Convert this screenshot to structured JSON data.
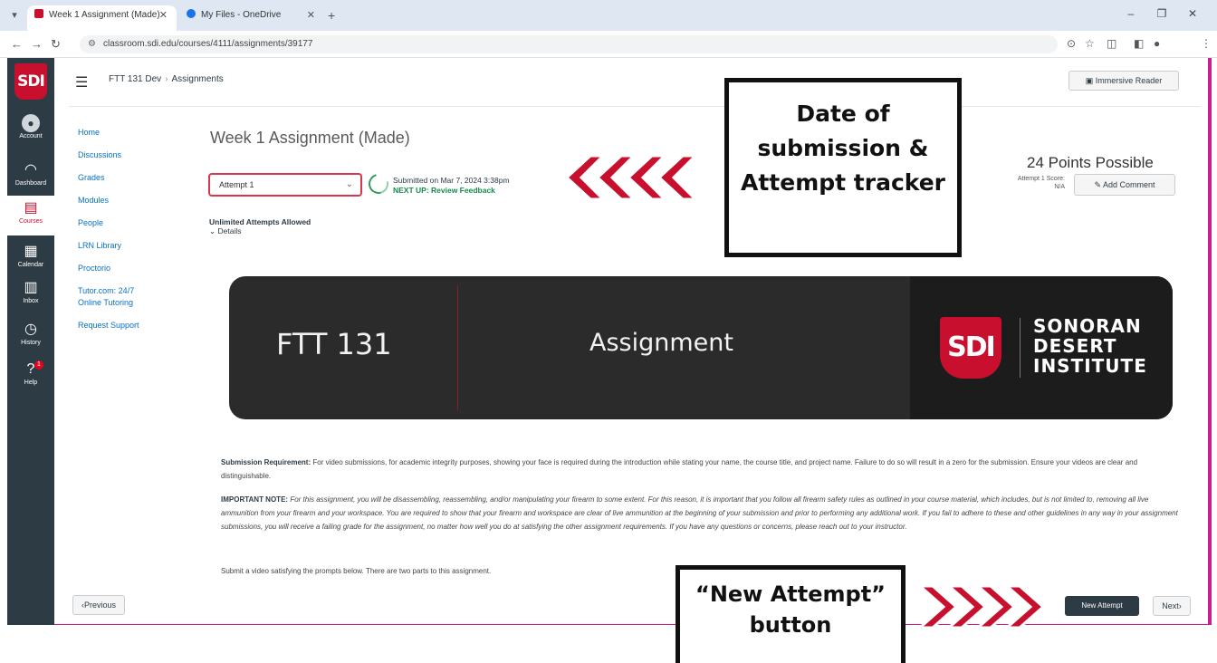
{
  "browser": {
    "tabs": [
      {
        "title": "Week 1 Assignment (Made)",
        "active": true
      },
      {
        "title": "My Files - OneDrive",
        "active": false
      }
    ],
    "url": "classroom.sdi.edu/courses/4111/assignments/39177"
  },
  "global_nav": {
    "items": [
      {
        "label": "Account",
        "icon": "account-icon"
      },
      {
        "label": "Dashboard",
        "icon": "dashboard-icon"
      },
      {
        "label": "Courses",
        "icon": "courses-icon"
      },
      {
        "label": "Calendar",
        "icon": "calendar-icon"
      },
      {
        "label": "Inbox",
        "icon": "inbox-icon"
      },
      {
        "label": "History",
        "icon": "history-icon"
      },
      {
        "label": "Help",
        "icon": "help-icon"
      }
    ],
    "help_badge": "1",
    "logo_text": "SDI"
  },
  "header": {
    "course": "FTT 131 Dev",
    "page": "Assignments",
    "immersive_reader": "Immersive Reader"
  },
  "course_nav": [
    "Home",
    "Discussions",
    "Grades",
    "Modules",
    "People",
    "LRN Library",
    "Proctorio",
    "Tutor.com: 24/7 Online Tutoring",
    "Request Support"
  ],
  "assignment": {
    "title": "Week 1 Assignment (Made)",
    "points": "24 Points Possible",
    "attempt_selected": "Attempt 1",
    "submitted": "Submitted on Mar 7, 2024 3:38pm",
    "next_up": "NEXT UP: Review Feedback",
    "attempt_score": "Attempt 1 Score: N/A",
    "add_comment": "Add Comment",
    "unlimited": "Unlimited Attempts Allowed",
    "details": "Details"
  },
  "banner": {
    "course": "FTT 131",
    "label": "Assignment",
    "logo": "SDI",
    "institute": "SONORAN DESERT INSTITUTE"
  },
  "body": {
    "p1_label": "Submission Requirement:",
    "p1_text": "For video submissions, for academic integrity purposes, showing your face is required during the introduction while stating your name, the course title, and project name. Failure to do so will result in a zero for the submission. Ensure your videos are clear and distinguishable.",
    "p2_label": "IMPORTANT NOTE:",
    "p2_text": "For this assignment, you will be disassembling, reassembling, and/or manipulating your firearm to some extent. For this reason, it is important that you follow all firearm safety rules as outlined in your course material, which includes, but is not limited to, removing all live ammunition from your firearm and your workspace. You are required to show that your firearm and workspace are clear of live ammunition at the beginning of your submission and prior to performing any additional work. If you fail to adhere to these and other guidelines in any way in your assignment submissions, you will receive a failing grade for the assignment, no matter how well you do at satisfying the other assignment requirements. If you have any questions or concerns, please reach out to your instructor.",
    "p3_text": "Submit a video satisfying the prompts below. There are two parts to this assignment."
  },
  "footer": {
    "previous": "Previous",
    "new_attempt": "New Attempt",
    "next": "Next"
  },
  "annotations": {
    "callout_top": "Date of submission & Attempt tracker",
    "callout_bottom": "“New Attempt” button"
  },
  "colors": {
    "brand_red": "#c8102e",
    "nav_dark": "#2d3b45",
    "link_blue": "#0770c5",
    "arrow_red": "#c8102e"
  }
}
